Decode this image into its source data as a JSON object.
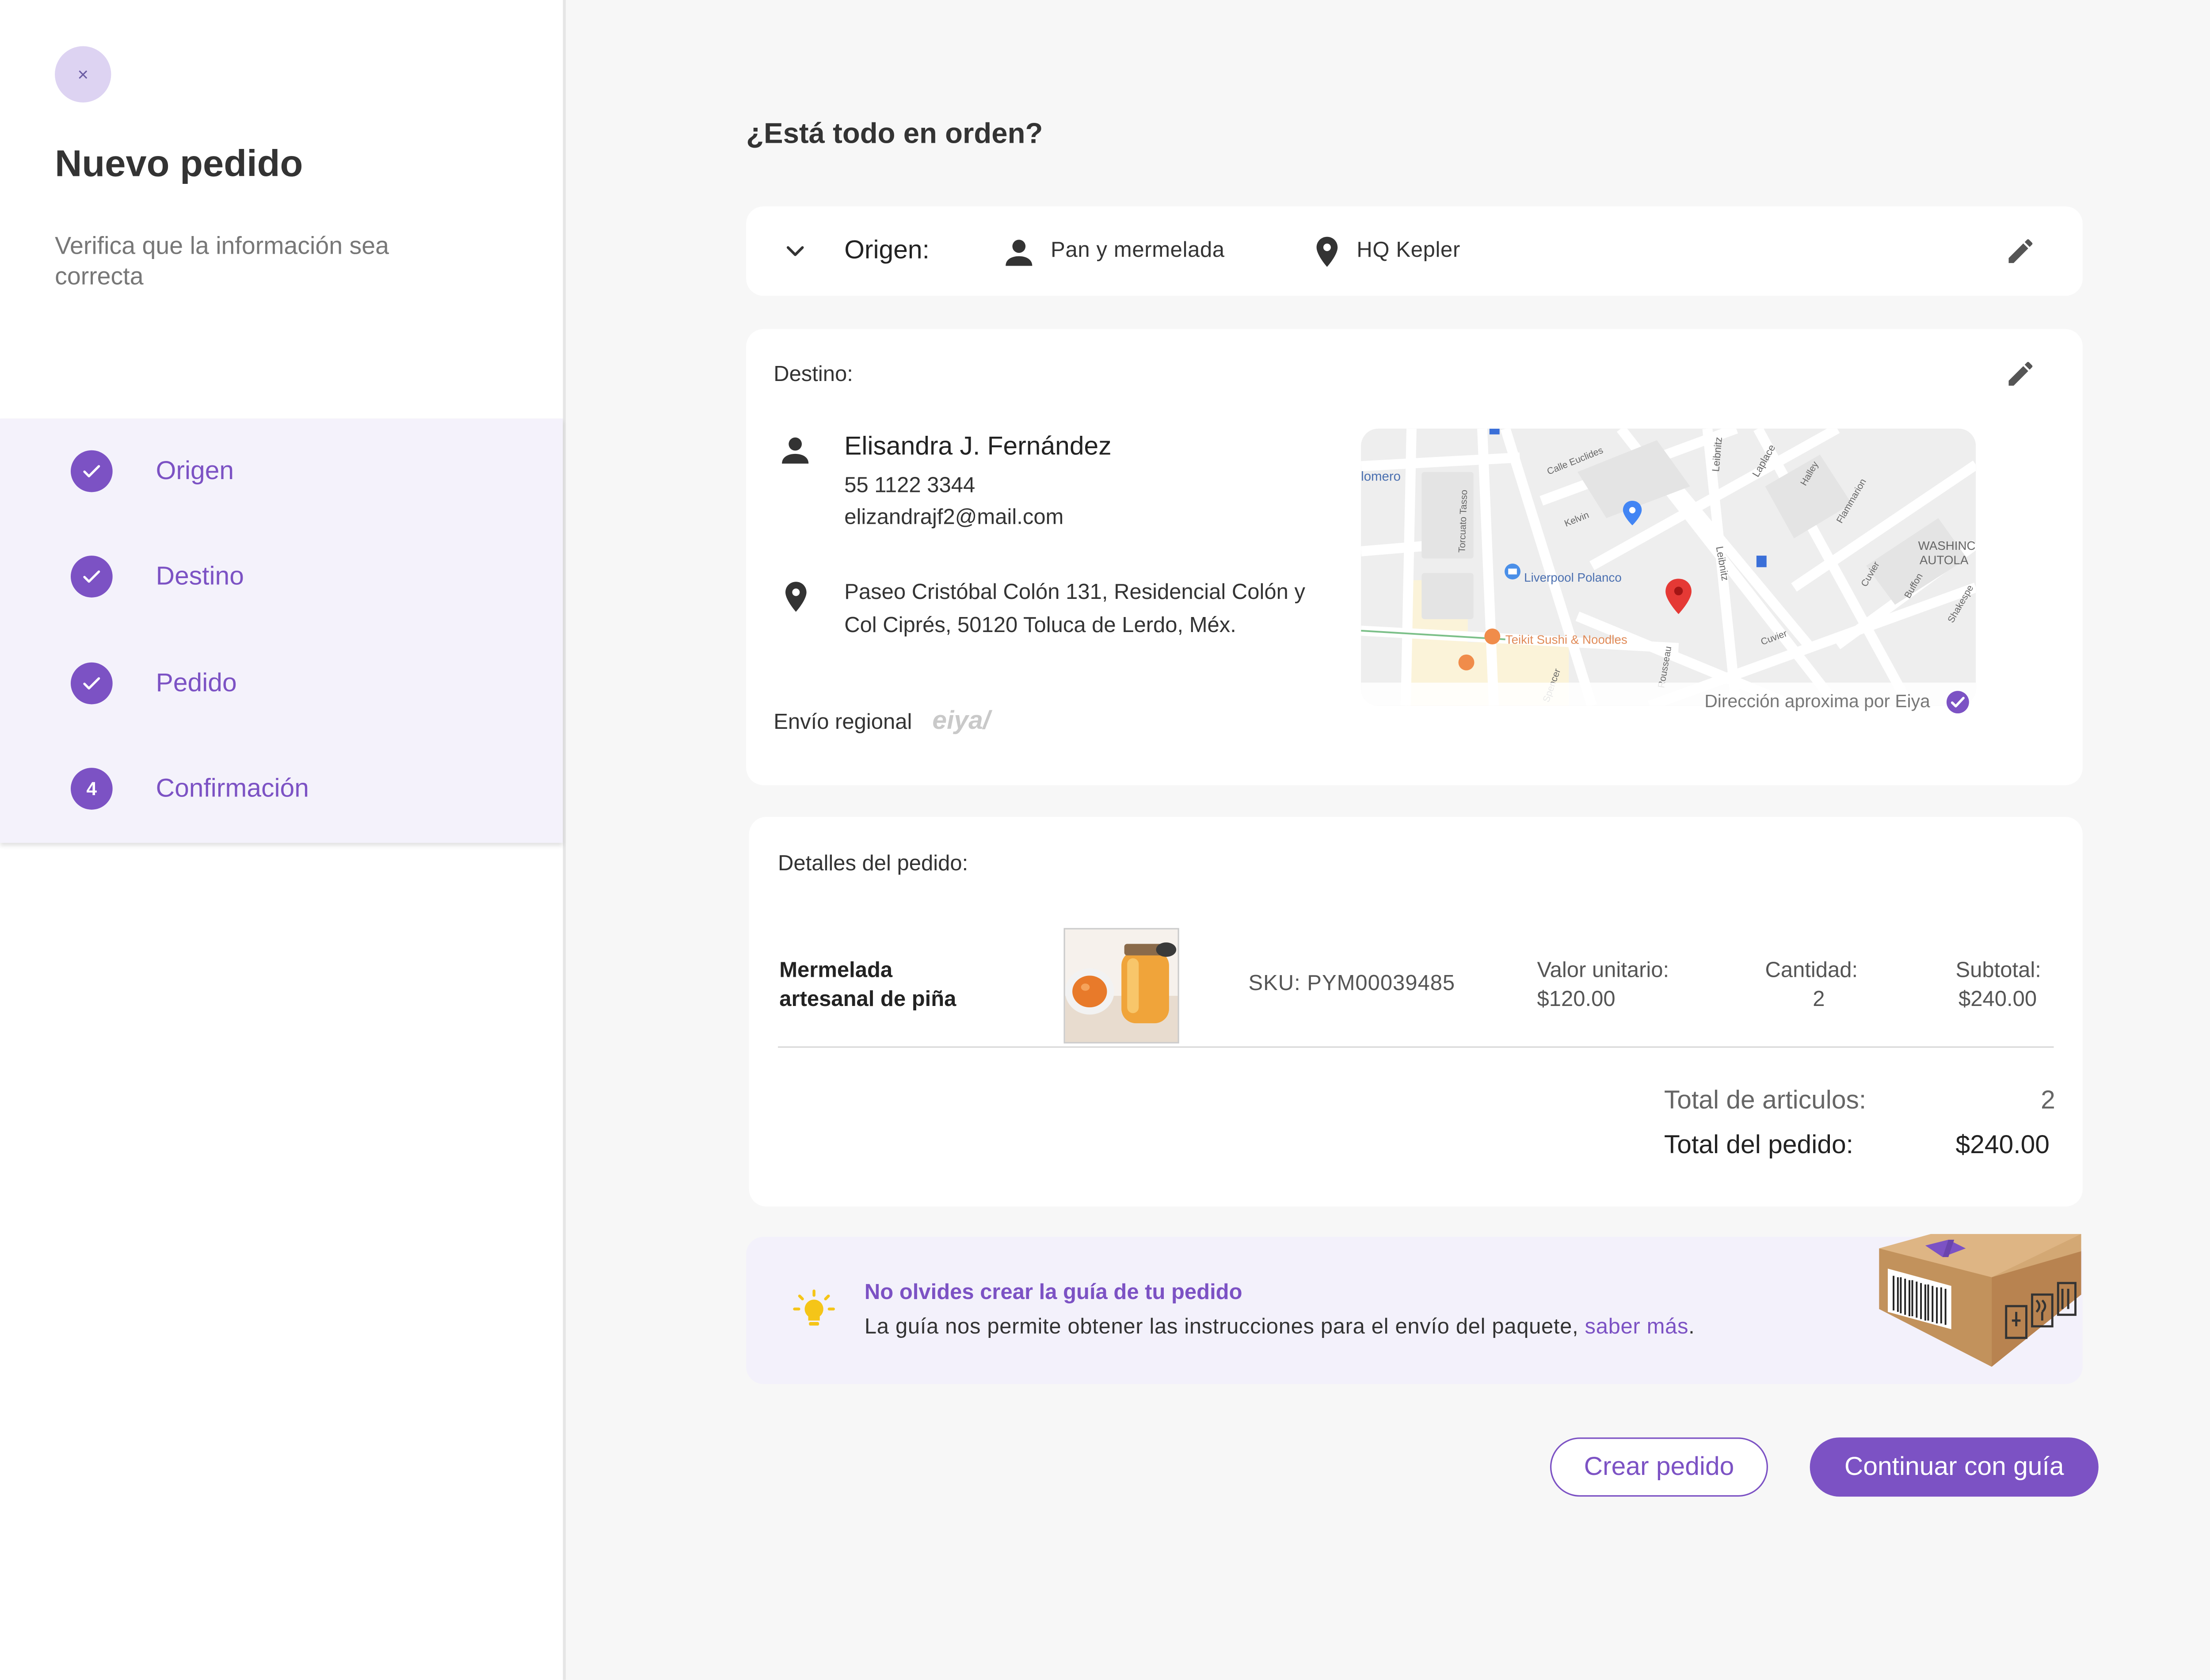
{
  "sidebar": {
    "close_label": "×",
    "title": "Nuevo pedido",
    "subtitle": "Verifica que la información sea correcta",
    "steps": [
      {
        "label": "Origen",
        "status": "completed",
        "marker": ""
      },
      {
        "label": "Destino",
        "status": "completed",
        "marker": ""
      },
      {
        "label": "Pedido",
        "status": "completed",
        "marker": ""
      },
      {
        "label": "Confirmación",
        "status": "current",
        "marker": "4"
      }
    ]
  },
  "main": {
    "heading": "¿Está todo en orden?",
    "origin": {
      "label": "Origen:",
      "person": "Pan y mermelada",
      "place": "HQ Kepler"
    },
    "destination": {
      "label": "Destino:",
      "name": "Elisandra J. Fernández",
      "phone": "55 1122 3344",
      "email": "elizandrajf2@mail.com",
      "address": "Paseo Cristóbal Colón 131, Residencial Colón y Col Ciprés, 50120 Toluca de Lerdo, Méx.",
      "shipping_type": "Envío regional",
      "brand": "eiya/",
      "map": {
        "caption": "Dirección aproxima por Eiya",
        "labels": {
          "homero": "lomero",
          "calle_euclides": "Calle Euclides",
          "kelvin": "Kelvin",
          "leibnitz": "Leibnitz",
          "laplace": "Laplace",
          "halley": "Halley",
          "flammarion": "Flammarion",
          "washington": "WASHINC",
          "autolavado": "AUTOLA",
          "torcuato_tasso": "Torcuato Tasso",
          "liverpool": "Liverpool Polanco",
          "teikit": "Teikit Sushi & Noodles",
          "rousseau": "Rousseau",
          "cuvier": "Cuvier",
          "buffon": "Buffon",
          "shakespeare": "Shakespe",
          "spencer": "Spencer",
          "cuvier2": "Cuvier"
        }
      }
    },
    "order": {
      "label": "Detalles del pedido:",
      "item": {
        "name": "Mermelada artesanal de piña",
        "sku": "SKU: PYM00039485",
        "unit_price_label": "Valor unitario:",
        "unit_price": "$120.00",
        "quantity_label": "Cantidad:",
        "quantity": "2",
        "subtotal_label": "Subtotal:",
        "subtotal": "$240.00"
      },
      "total_items_label": "Total de articulos:",
      "total_items": "2",
      "total_order_label": "Total del pedido:",
      "total_order": "$240.00"
    },
    "tip": {
      "title": "No olvides crear la guía de tu pedido",
      "body": "La guía nos permite obtener las instrucciones para el envío del paquete, ",
      "link": "saber más",
      "body_end": "."
    },
    "buttons": {
      "create": "Crear pedido",
      "continue": "Continuar con guía"
    }
  },
  "colors": {
    "accent": "#7c52c4",
    "accent_light": "#f3f1fb",
    "close_bg": "#ddd3f2",
    "map_pin": "#e53935",
    "tip_bulb": "#f5c518"
  },
  "icons": {
    "close": "close-icon",
    "check": "check-icon",
    "chevron": "chevron-down-icon",
    "person": "person-icon",
    "location": "location-pin-icon",
    "edit": "pencil-icon",
    "verified": "verified-check-icon",
    "bulb": "lightbulb-icon",
    "box": "package-box-icon"
  }
}
